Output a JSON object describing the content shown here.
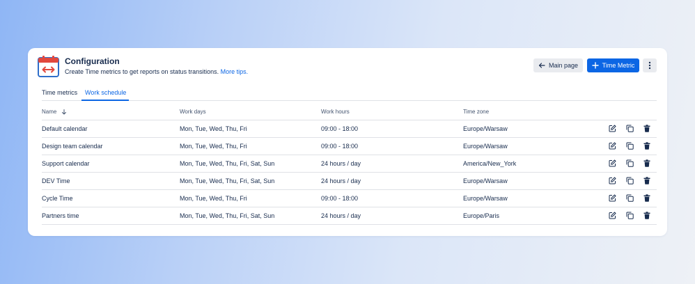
{
  "header": {
    "title": "Configuration",
    "subtitle": "Create Time metrics to get reports on status transitions.",
    "tips_link": "More tips.",
    "app_icon": "calendar-transition-icon"
  },
  "buttons": {
    "main_page": "Main page",
    "time_metric": "Time Metric",
    "more": "more-options-icon"
  },
  "tabs": [
    {
      "label": "Time metrics",
      "active": false
    },
    {
      "label": "Work schedule",
      "active": true
    }
  ],
  "table": {
    "columns": [
      "Name",
      "Work days",
      "Work hours",
      "Time zone"
    ],
    "sort": {
      "column": "Name",
      "direction": "descending-arrow"
    },
    "rows": [
      {
        "name": "Default calendar",
        "days": "Mon, Tue, Wed, Thu, Fri",
        "hours": "09:00 - 18:00",
        "tz": "Europe/Warsaw"
      },
      {
        "name": "Design team calendar",
        "days": "Mon, Tue, Wed, Thu, Fri",
        "hours": "09:00 - 18:00",
        "tz": "Europe/Warsaw"
      },
      {
        "name": "Support calendar",
        "days": "Mon, Tue, Wed, Thu, Fri, Sat, Sun",
        "hours": "24 hours / day",
        "tz": "America/New_York"
      },
      {
        "name": "DEV Time",
        "days": "Mon, Tue, Wed, Thu, Fri, Sat, Sun",
        "hours": "24 hours / day",
        "tz": "Europe/Warsaw"
      },
      {
        "name": "Cycle Time",
        "days": "Mon, Tue, Wed, Thu, Fri",
        "hours": "09:00 - 18:00",
        "tz": "Europe/Warsaw"
      },
      {
        "name": "Partners time",
        "days": "Mon, Tue, Wed, Thu, Fri, Sat, Sun",
        "hours": "24 hours / day",
        "tz": "Europe/Paris"
      }
    ],
    "row_actions": [
      "edit-icon",
      "copy-icon",
      "delete-icon"
    ]
  },
  "colors": {
    "primary": "#0c66e4",
    "text": "#172b4d",
    "muted": "#44546f",
    "icon_red": "#e2483d",
    "icon_blue": "#2f6ec9"
  }
}
